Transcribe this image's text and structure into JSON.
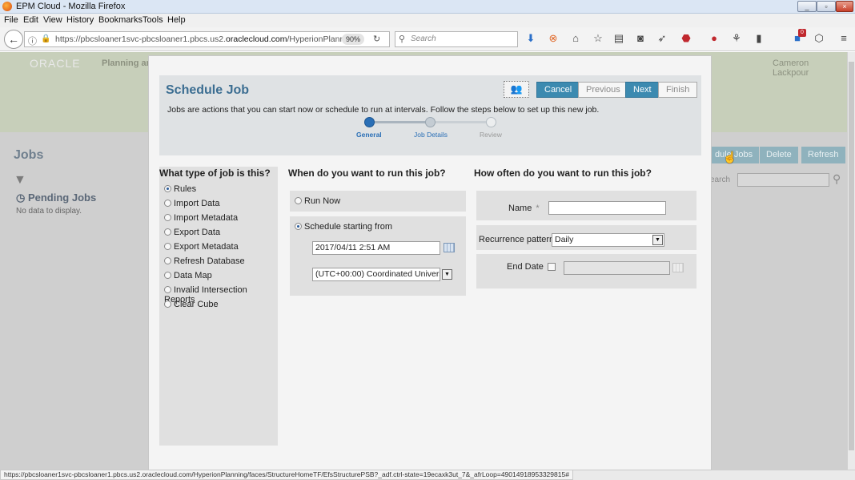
{
  "window": {
    "title": "EPM Cloud - Mozilla Firefox",
    "controls": [
      "_",
      "▫",
      "×"
    ]
  },
  "menu": [
    "File",
    "Edit",
    "View",
    "History",
    "Bookmarks",
    "Tools",
    "Help"
  ],
  "nav": {
    "url_prefix": "https://pbcsloaner1svc-pbcsloaner1.pbcs.us2.",
    "url_domain": "oraclecloud.com",
    "url_suffix": "/HyperionPlanning",
    "zoom": "90%",
    "search_placeholder": "Search",
    "badge": "0"
  },
  "app": {
    "logo": "ORACLE",
    "product": "Planning ar",
    "user": "Cameron Lackpour",
    "jobs_title": "Jobs",
    "pending_jobs": "Pending Jobs",
    "no_data": "No data to display.",
    "buttons": {
      "schedule": "dule Jobs",
      "delete": "Delete",
      "refresh": "Refresh"
    },
    "search_label": "earch"
  },
  "dialog": {
    "title": "Schedule Job",
    "description": "Jobs are actions that you can start now or schedule to run at intervals. Follow the steps below to set up this new job.",
    "buttons": {
      "cancel": "Cancel",
      "previous": "Previous",
      "next": "Next",
      "finish": "Finish"
    },
    "steps": [
      {
        "label": "General",
        "state": "current"
      },
      {
        "label": "Job Details",
        "state": "next"
      },
      {
        "label": "Review",
        "state": "inactive"
      }
    ],
    "job_type": {
      "heading": "What type of job is this?",
      "options": [
        "Rules",
        "Import Data",
        "Import Metadata",
        "Export Data",
        "Export Metadata",
        "Refresh Database",
        "Data Map",
        "Invalid Intersection Reports",
        "Clear Cube"
      ],
      "selected": "Rules"
    },
    "when": {
      "heading": "When do you want to run this job?",
      "run_now": "Run Now",
      "schedule_from": "Schedule starting from",
      "selected": "Schedule starting from",
      "datetime": "2017/04/11 2:51 AM",
      "timezone": "(UTC+00:00) Coordinated Universal"
    },
    "how_often": {
      "heading": "How often do you want to run this job?",
      "name_label": "Name",
      "required_mark": "*",
      "name_value": "",
      "recurrence_label": "Recurrence pattern",
      "recurrence_value": "Daily",
      "end_date_label": "End Date",
      "end_date_checked": false,
      "end_date_value": ""
    }
  },
  "status_url": "https://pbcsloaner1svc-pbcsloaner1.pbcs.us2.oraclecloud.com/HyperionPlanning/faces/StructureHomeTF/EfsStructurePSB?_adf.ctrl-state=19ecaxk3ut_7&_afrLoop=49014918953329815#",
  "colors": {
    "accent": "#3c8ab0",
    "title_blue": "#3c6e92",
    "step_active": "#2a6fb6"
  }
}
